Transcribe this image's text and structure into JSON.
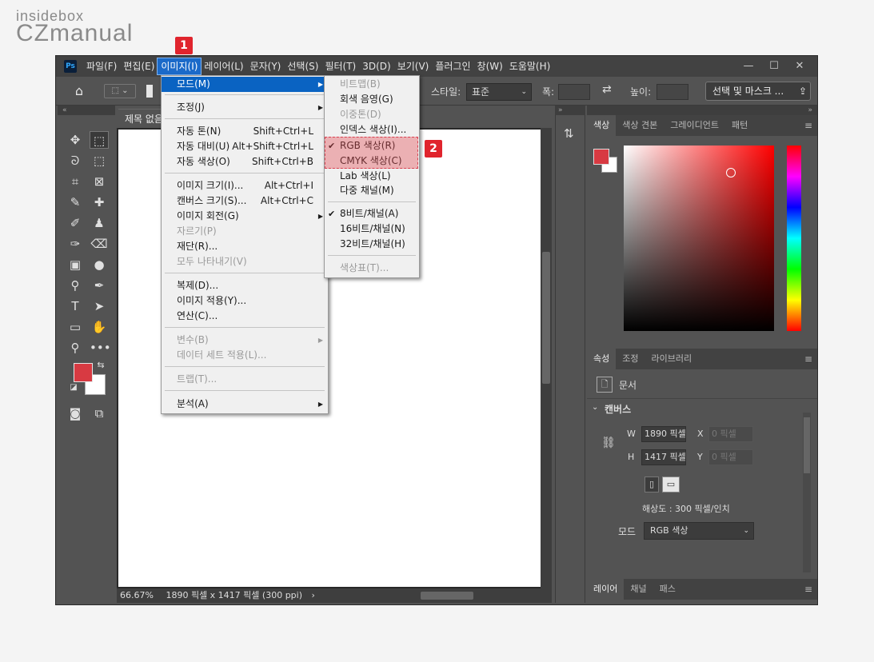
{
  "watermark": {
    "line1": "insidebox",
    "line2": "CZmanual"
  },
  "menubar": {
    "logo": "Ps",
    "items": [
      "파일(F)",
      "편집(E)",
      "이미지(I)",
      "레이어(L)",
      "문자(Y)",
      "선택(S)",
      "필터(T)",
      "3D(D)",
      "보기(V)",
      "플러그인",
      "창(W)",
      "도움말(H)"
    ],
    "active_index": 2,
    "window_buttons": [
      "—",
      "☐",
      "✕"
    ]
  },
  "options": {
    "style_label": "스타일:",
    "style_value": "표준",
    "width_label": "폭:",
    "height_label": "높이:",
    "select_mask": "선택 및 마스크 ..."
  },
  "document": {
    "tab": "제목 없음",
    "status_zoom": "66.67%",
    "status_info": "1890 픽셀 x 1417 픽셀 (300 ppi)"
  },
  "color_panel": {
    "tabs": [
      "색상",
      "색상 견본",
      "그레이디언트",
      "패턴"
    ],
    "fg_color": "#d83a42",
    "bg_color": "#ffffff"
  },
  "props_panel": {
    "tabs": [
      "속성",
      "조정",
      "라이브러리"
    ],
    "doc_label": "문서",
    "section": "캔버스",
    "w_label": "W",
    "w_value": "1890 픽셀",
    "h_label": "H",
    "h_value": "1417 픽셀",
    "x_label": "X",
    "x_value": "0 픽셀",
    "y_label": "Y",
    "y_value": "0 픽셀",
    "resolution": "해상도 : 300 픽셀/인치",
    "mode_label": "모드",
    "mode_value": "RGB 색상"
  },
  "layers_panel": {
    "tabs": [
      "레이어",
      "채널",
      "패스"
    ]
  },
  "image_menu": {
    "items": [
      {
        "label": "모드(M)",
        "shortcut": "",
        "submenu": true,
        "disabled": false,
        "highlight": true
      },
      {
        "label": "조정(J)",
        "shortcut": "",
        "submenu": true,
        "disabled": false,
        "highlight": false
      },
      {
        "label": "자동 톤(N)",
        "shortcut": "Shift+Ctrl+L",
        "submenu": false,
        "disabled": false,
        "highlight": false
      },
      {
        "label": "자동 대비(U)",
        "shortcut": "Alt+Shift+Ctrl+L",
        "submenu": false,
        "disabled": false,
        "highlight": false
      },
      {
        "label": "자동 색상(O)",
        "shortcut": "Shift+Ctrl+B",
        "submenu": false,
        "disabled": false,
        "highlight": false
      },
      {
        "label": "이미지 크기(I)...",
        "shortcut": "Alt+Ctrl+I",
        "submenu": false,
        "disabled": false,
        "highlight": false
      },
      {
        "label": "캔버스 크기(S)...",
        "shortcut": "Alt+Ctrl+C",
        "submenu": false,
        "disabled": false,
        "highlight": false
      },
      {
        "label": "이미지 회전(G)",
        "shortcut": "",
        "submenu": true,
        "disabled": false,
        "highlight": false
      },
      {
        "label": "자르기(P)",
        "shortcut": "",
        "submenu": false,
        "disabled": true,
        "highlight": false
      },
      {
        "label": "재단(R)...",
        "shortcut": "",
        "submenu": false,
        "disabled": false,
        "highlight": false
      },
      {
        "label": "모두 나타내기(V)",
        "shortcut": "",
        "submenu": false,
        "disabled": true,
        "highlight": false
      },
      {
        "label": "복제(D)...",
        "shortcut": "",
        "submenu": false,
        "disabled": false,
        "highlight": false
      },
      {
        "label": "이미지 적용(Y)...",
        "shortcut": "",
        "submenu": false,
        "disabled": false,
        "highlight": false
      },
      {
        "label": "연산(C)...",
        "shortcut": "",
        "submenu": false,
        "disabled": false,
        "highlight": false
      },
      {
        "label": "변수(B)",
        "shortcut": "",
        "submenu": true,
        "disabled": true,
        "highlight": false
      },
      {
        "label": "데이터 세트 적용(L)...",
        "shortcut": "",
        "submenu": false,
        "disabled": true,
        "highlight": false
      },
      {
        "label": "트랩(T)...",
        "shortcut": "",
        "submenu": false,
        "disabled": true,
        "highlight": false
      },
      {
        "label": "분석(A)",
        "shortcut": "",
        "submenu": true,
        "disabled": false,
        "highlight": false
      }
    ]
  },
  "mode_submenu": {
    "items": [
      {
        "label": "비트맵(B)",
        "disabled": true,
        "checked": false
      },
      {
        "label": "회색 음영(G)",
        "disabled": false,
        "checked": false
      },
      {
        "label": "이중톤(D)",
        "disabled": true,
        "checked": false
      },
      {
        "label": "인덱스 색상(I)...",
        "disabled": false,
        "checked": false
      },
      {
        "label": "RGB 색상(R)",
        "disabled": false,
        "checked": true
      },
      {
        "label": "CMYK 색상(C)",
        "disabled": false,
        "checked": false
      },
      {
        "label": "Lab 색상(L)",
        "disabled": false,
        "checked": false
      },
      {
        "label": "다중 채널(M)",
        "disabled": false,
        "checked": false
      },
      {
        "label": "8비트/채널(A)",
        "disabled": false,
        "checked": true
      },
      {
        "label": "16비트/채널(N)",
        "disabled": false,
        "checked": false
      },
      {
        "label": "32비트/채널(H)",
        "disabled": false,
        "checked": false
      },
      {
        "label": "색상표(T)...",
        "disabled": true,
        "checked": false
      }
    ]
  },
  "badges": [
    "1",
    "2"
  ],
  "highlight_color": "#e0242d"
}
